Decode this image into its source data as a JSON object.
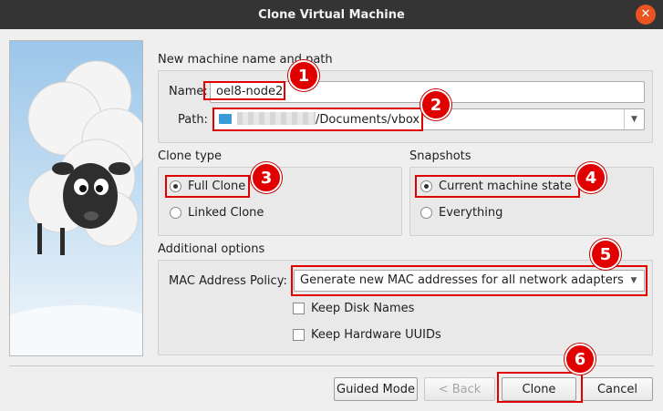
{
  "window": {
    "title": "Clone Virtual Machine",
    "close_glyph": "✕"
  },
  "name_path": {
    "section_title": "New machine name and path",
    "name_label": "Name:",
    "name_value": "oel8-node2",
    "path_label": "Path:",
    "path_value": "/Documents/vbox"
  },
  "clone_type": {
    "title": "Clone type",
    "options": [
      {
        "label": "Full Clone",
        "checked": true
      },
      {
        "label": "Linked Clone",
        "checked": false
      }
    ]
  },
  "snapshots": {
    "title": "Snapshots",
    "options": [
      {
        "label": "Current machine state",
        "checked": true
      },
      {
        "label": "Everything",
        "checked": false
      }
    ]
  },
  "additional": {
    "title": "Additional options",
    "mac_label": "MAC Address Policy:",
    "mac_value": "Generate new MAC addresses for all network adapters",
    "keep_disk_names": "Keep Disk Names",
    "keep_hardware_uuids": "Keep Hardware UUIDs"
  },
  "buttons": {
    "guided_mode": "Guided Mode",
    "back": "< Back",
    "clone": "Clone",
    "cancel": "Cancel"
  },
  "annotations": [
    "1",
    "2",
    "3",
    "4",
    "5",
    "6"
  ],
  "colors": {
    "highlight": "#e00000",
    "titlebar": "#343434",
    "close": "#e95420"
  }
}
